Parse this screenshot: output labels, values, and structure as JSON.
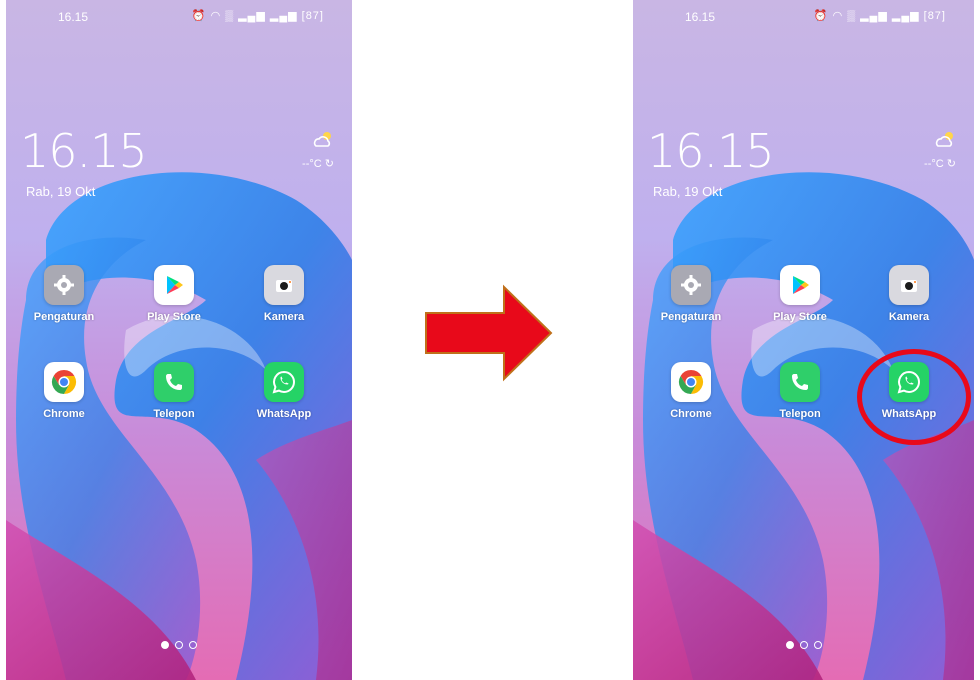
{
  "screens": [
    {
      "status_time": "16.15",
      "status_icons": "⏰ ◠ ▒ ▂▄▆ ▂▄▆ [87]",
      "clock": "16.15",
      "date": "Rab, 19 Okt",
      "weather_temp": "--°C ↻",
      "apps": [
        {
          "label": "Pengaturan",
          "icon": "settings-gear-icon"
        },
        {
          "label": "Play Store",
          "icon": "play-store-icon"
        },
        {
          "label": "Kamera",
          "icon": "camera-icon"
        },
        {
          "label": "Chrome",
          "icon": "chrome-icon"
        },
        {
          "label": "Telepon",
          "icon": "phone-icon"
        },
        {
          "label": "WhatsApp",
          "icon": "whatsapp-icon"
        }
      ],
      "page_indicator": {
        "pages": 3,
        "active": 0
      }
    },
    {
      "status_time": "16.15",
      "status_icons": "⏰ ◠ ▒ ▂▄▆ ▂▄▆ [87]",
      "clock": "16.15",
      "date": "Rab, 19 Okt",
      "weather_temp": "--°C ↻",
      "apps": [
        {
          "label": "Pengaturan",
          "icon": "settings-gear-icon"
        },
        {
          "label": "Play Store",
          "icon": "play-store-icon"
        },
        {
          "label": "Kamera",
          "icon": "camera-icon"
        },
        {
          "label": "Chrome",
          "icon": "chrome-icon"
        },
        {
          "label": "Telepon",
          "icon": "phone-icon"
        },
        {
          "label": "WhatsApp",
          "icon": "whatsapp-icon"
        }
      ],
      "page_indicator": {
        "pages": 3,
        "active": 0
      },
      "highlighted_app": "WhatsApp"
    }
  ],
  "colors": {
    "arrow": "#e8091a",
    "arrow_outline": "#c0701a",
    "highlight": "#e8091a",
    "whatsapp": "#25d366",
    "phone_app": "#2fcf6a"
  }
}
